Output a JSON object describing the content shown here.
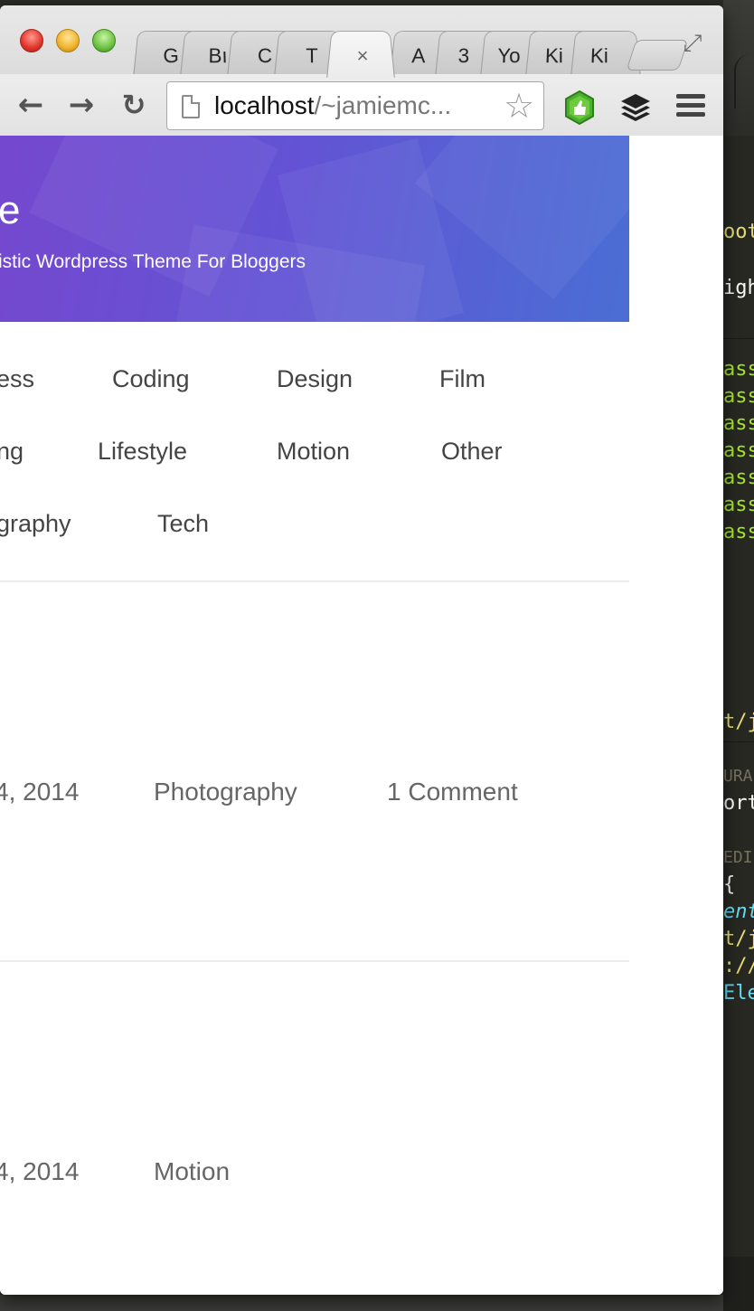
{
  "browser": {
    "tabs": [
      {
        "label": "G",
        "active": false
      },
      {
        "label": "Bı",
        "active": false
      },
      {
        "label": "C",
        "active": false
      },
      {
        "label": "T",
        "active": false
      },
      {
        "label": "×",
        "active": true
      },
      {
        "label": "A",
        "active": false
      },
      {
        "label": "3",
        "active": false
      },
      {
        "label": "Yo",
        "active": false
      },
      {
        "label": "Ki",
        "active": false
      },
      {
        "label": "Ki",
        "active": false
      }
    ],
    "url_host": "localhost",
    "url_path": "/~jamiemc...",
    "icons": [
      "back-icon",
      "forward-icon",
      "reload-icon",
      "page-icon",
      "star-icon",
      "extension-icon",
      "buffer-icon",
      "menu-icon"
    ]
  },
  "site": {
    "title_fragment": "e",
    "tagline_fragment": "istic Wordpress Theme For Bloggers",
    "hero_colors": [
      "#7548cf",
      "#4a6ed4"
    ]
  },
  "categories": {
    "row1": [
      "ess",
      "Coding",
      "Design",
      "Film"
    ],
    "row2": [
      "ng",
      "Lifestyle",
      "Motion",
      "Other"
    ],
    "row3": [
      "graphy",
      "Tech"
    ]
  },
  "posts": [
    {
      "date": "4, 2014",
      "category": "Photography",
      "comments": "1 Comment"
    },
    {
      "date": "4, 2014",
      "category": "Motion",
      "comments": ""
    }
  ],
  "editor": {
    "lines": [
      {
        "text": "oot",
        "color": "#e6db74"
      },
      {
        "text": "igh",
        "color": "#f8f8f2"
      },
      {
        "text": "ass",
        "color": "#a6e22e"
      },
      {
        "text": "ass",
        "color": "#a6e22e"
      },
      {
        "text": "ass",
        "color": "#a6e22e"
      },
      {
        "text": "ass",
        "color": "#a6e22e"
      },
      {
        "text": "ass",
        "color": "#a6e22e"
      },
      {
        "text": "ass",
        "color": "#a6e22e"
      },
      {
        "text": "ass",
        "color": "#a6e22e"
      },
      {
        "text": "t/j",
        "color": "#e6db74"
      },
      {
        "text": "URA",
        "color": "#75715e"
      },
      {
        "text": "ort",
        "color": "#f8f8f2"
      },
      {
        "text": "EDI",
        "color": "#75715e"
      },
      {
        "text": "{",
        "color": "#f8f8f2"
      },
      {
        "text": "ent",
        "color": "#66d9ef"
      },
      {
        "text": "t/j",
        "color": "#e6db74"
      },
      {
        "text": "://",
        "color": "#e6db74"
      },
      {
        "text": "Ele",
        "color": "#66d9ef"
      }
    ]
  }
}
